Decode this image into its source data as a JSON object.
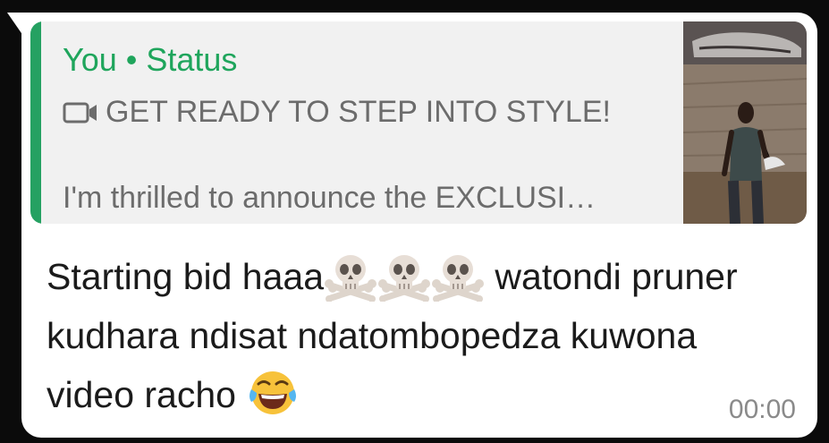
{
  "quoted_status": {
    "author": "You • Status",
    "media_icon": "video-camera-icon",
    "title": "GET READY TO STEP INTO STYLE!",
    "preview": "I'm thrilled to announce the EXCLUSI…"
  },
  "message": {
    "text_part1": "Starting bid haaa",
    "emoji_skull": "☠️",
    "text_part2": " watondi pruner kudhara ndisat ndatombopedza kuwona video racho ",
    "emoji_laugh": "😂",
    "time": "00:00"
  },
  "colors": {
    "accent_green": "#1fa55c",
    "bubble_bg": "#ffffff",
    "quote_bg": "#f1f1f1",
    "app_bg": "#0b0b0b"
  }
}
